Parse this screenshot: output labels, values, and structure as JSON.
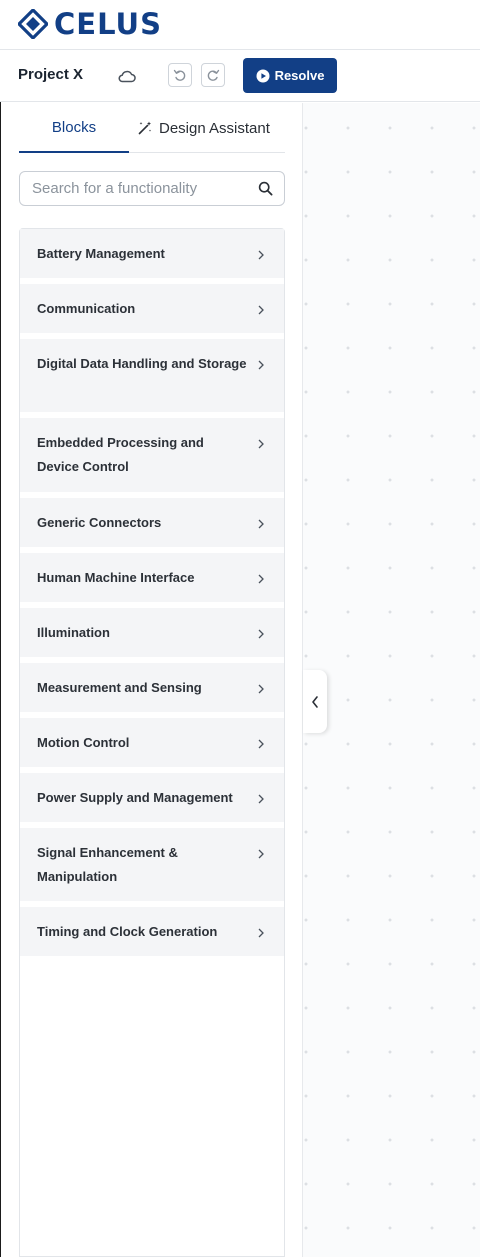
{
  "app": {
    "logo_text": "CELUS",
    "brand_color": "#123f86"
  },
  "toolbar": {
    "project_name": "Project X",
    "cloud_icon": "cloud-icon",
    "undo_icon": "undo-icon",
    "redo_icon": "redo-icon",
    "resolve_label": "Resolve"
  },
  "sidebar": {
    "tabs": [
      {
        "label": "Blocks",
        "active": true
      },
      {
        "label": "Design Assistant",
        "active": false,
        "icon": "magic-wand-icon"
      }
    ],
    "search": {
      "placeholder": "Search for a functionality",
      "value": ""
    },
    "blocks": [
      {
        "label": "Battery Management"
      },
      {
        "label": "Communication"
      },
      {
        "label": "Digital Data Handling and Storage"
      },
      {
        "label": "Embedded Processing and Device Control"
      },
      {
        "label": "Generic Connectors"
      },
      {
        "label": "Human Machine Interface"
      },
      {
        "label": "Illumination"
      },
      {
        "label": "Measurement and Sensing"
      },
      {
        "label": "Motion Control"
      },
      {
        "label": "Power Supply and Management"
      },
      {
        "label": "Signal Enhancement & Manipulation"
      },
      {
        "label": "Timing and Clock Generation"
      }
    ]
  },
  "canvas": {
    "collapse_icon": "chevron-left-icon"
  }
}
